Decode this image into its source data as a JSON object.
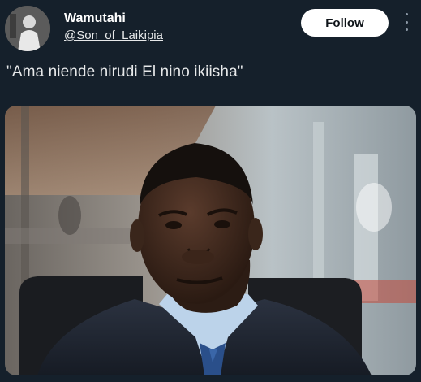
{
  "author": {
    "display_name": "Wamutahi",
    "handle": "@Son_of_Laikipia"
  },
  "follow_label": "Follow",
  "more_icon": "more-vertical-icon",
  "tweet": {
    "text": "\"Ama niende nirudi El nino ikiisha\""
  }
}
